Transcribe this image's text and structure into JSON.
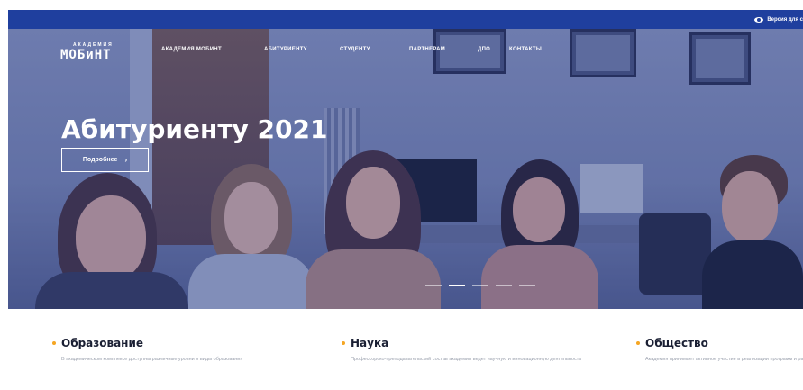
{
  "topbar": {
    "visually_impaired_label": "Версия для с",
    "icon": "eye-icon",
    "color": "#1f3f9e"
  },
  "header": {
    "logo_small": "АКАДЕМИЯ",
    "logo_main": "МОБиНТ",
    "nav": [
      {
        "label": "Академия МОБиНТ"
      },
      {
        "label": "Абитуриенту"
      },
      {
        "label": "Студенту"
      },
      {
        "label": "Партнерам"
      },
      {
        "label": "ДПО"
      },
      {
        "label": "Контакты"
      }
    ]
  },
  "hero": {
    "title": "Абитуриенту 2021",
    "button_label": "Подробнее",
    "button_icon": "chevron-right-icon",
    "slides": 5,
    "active_slide": 2
  },
  "features": [
    {
      "title": "Образование",
      "text": "В академическом комплексе доступны различные уровни и виды образования"
    },
    {
      "title": "Наука",
      "text": "Профессорско-преподавательский состав академии ведет научную и инновационную деятельность"
    },
    {
      "title": "Общество",
      "text": "Академия принимает активное участие в реализации программ и развитии гражданского общества"
    }
  ],
  "colors": {
    "accent": "#f5a623",
    "brand": "#1f3f9e"
  }
}
